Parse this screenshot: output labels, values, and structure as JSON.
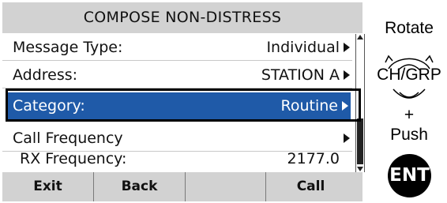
{
  "screen": {
    "title": "COMPOSE NON-DISTRESS",
    "rows": [
      {
        "label": "Message Type:",
        "value": "Individual",
        "arrow": true
      },
      {
        "label": "Address:",
        "value": "STATION A",
        "arrow": true
      },
      {
        "label": "Category:",
        "value": "Routine",
        "arrow": true,
        "selected": true
      },
      {
        "label": "Call Frequency",
        "value": "",
        "arrow": true
      },
      {
        "label": "RX Frequency:",
        "value": "2177.0",
        "arrow": false
      }
    ],
    "softkeys": [
      "Exit",
      "Back",
      "",
      "Call"
    ]
  },
  "controls": {
    "rotate_label": "Rotate",
    "dial_label": "CH/GRP",
    "plus_label": "+",
    "push_label": "Push",
    "ent_label": "ENT"
  },
  "colors": {
    "selection": "#1f5aa8",
    "title_bar": "#d2d2d2",
    "softkey_bar": "#d2d2d2"
  }
}
